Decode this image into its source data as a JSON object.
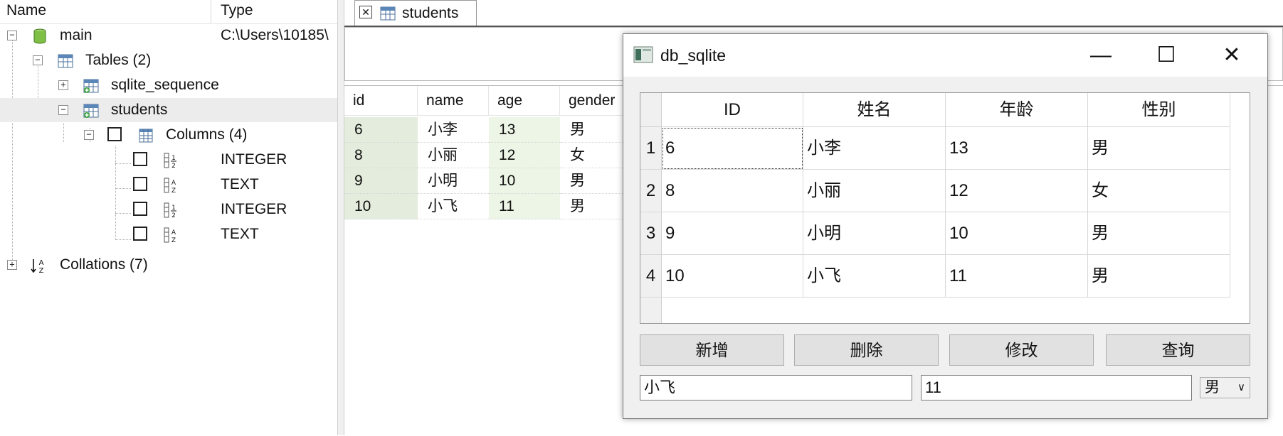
{
  "tree": {
    "col_name": "Name",
    "col_type": "Type",
    "main_label": "main",
    "main_type": "C:\\Users\\10185\\",
    "tables_label": "Tables (2)",
    "sqlite_sequence_label": "sqlite_sequence",
    "students_label": "students",
    "columns_label": "Columns (4)",
    "columns": [
      {
        "type": "INTEGER",
        "icon": "numeric-column-icon"
      },
      {
        "type": "TEXT",
        "icon": "text-column-icon"
      },
      {
        "type": "INTEGER",
        "icon": "numeric-column-icon"
      },
      {
        "type": "TEXT",
        "icon": "text-column-icon"
      }
    ],
    "collations_label": "Collations (7)"
  },
  "tab": {
    "label": "students"
  },
  "grid": {
    "headers": [
      "id",
      "name",
      "age",
      "gender"
    ],
    "rows": [
      [
        "6",
        "小李",
        "13",
        "男"
      ],
      [
        "8",
        "小丽",
        "12",
        "女"
      ],
      [
        "9",
        "小明",
        "10",
        "男"
      ],
      [
        "10",
        "小飞",
        "11",
        "男"
      ]
    ]
  },
  "dialog": {
    "title": "db_sqlite",
    "minimize_glyph": "—",
    "maximize_glyph": "☐",
    "close_glyph": "✕",
    "headers": [
      "ID",
      "姓名",
      "年龄",
      "性别"
    ],
    "row_numbers": [
      "1",
      "2",
      "3",
      "4"
    ],
    "rows": [
      [
        "6",
        "小李",
        "13",
        "男"
      ],
      [
        "8",
        "小丽",
        "12",
        "女"
      ],
      [
        "9",
        "小明",
        "10",
        "男"
      ],
      [
        "10",
        "小飞",
        "11",
        "男"
      ]
    ],
    "buttons": {
      "add": "新增",
      "delete": "删除",
      "edit": "修改",
      "query": "查询"
    },
    "name_input": "小飞",
    "age_input": "11",
    "gender_select": "男",
    "gender_arrow": "∨"
  },
  "colors": {
    "grid_id_bg": "#e4eddd",
    "grid_age_bg": "#edf6e6",
    "selected_tree_row": "#ececec",
    "dialog_bg": "#f0f0f0"
  }
}
